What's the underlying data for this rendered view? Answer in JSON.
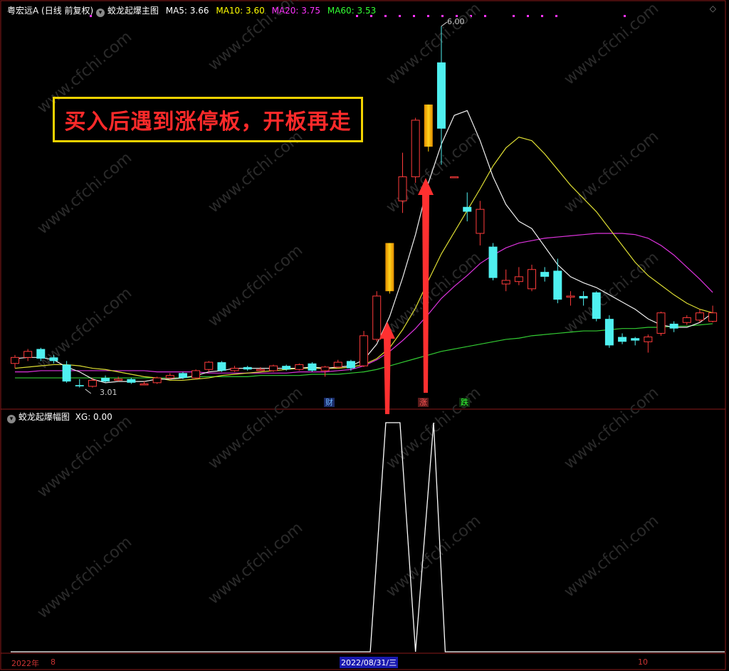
{
  "window": {
    "stock_name": "粤宏远A",
    "mode": "(日线 前复权)",
    "main_indicator": "蛟龙起爆主图",
    "ma": [
      {
        "label": "MA5: 3.66",
        "color": "#ffffff"
      },
      {
        "label": "MA10: 3.60",
        "color": "#ffff00"
      },
      {
        "label": "MA20: 3.75",
        "color": "#ff33ff"
      },
      {
        "label": "MA60: 3.53",
        "color": "#33ff33"
      }
    ],
    "sub_indicator": "蛟龙起爆幅图",
    "sub_value": "XG: 0.00"
  },
  "annotation": "买入后遇到涨停板，开板再走",
  "markers": [
    {
      "text": "财",
      "color": "#ff4444",
      "bg": "#1a2a66"
    },
    {
      "text": "涨",
      "color": "#ff4444",
      "bg": "#5a1a1a"
    },
    {
      "text": "跌",
      "color": "#33ff33",
      "bg": "#103010"
    }
  ],
  "price_labels": {
    "high": "6.00",
    "low": "3.01"
  },
  "xaxis": {
    "year": "2022年",
    "month1": "8",
    "cursor_date": "2022/08/31/三",
    "month2": "10"
  },
  "chart_data": {
    "type": "candlestick",
    "ylim": [
      2.85,
      6.1
    ],
    "candles": [
      {
        "o": 3.2,
        "c": 3.25,
        "h": 3.27,
        "l": 3.16
      },
      {
        "o": 3.25,
        "c": 3.3,
        "h": 3.32,
        "l": 3.22
      },
      {
        "o": 3.32,
        "c": 3.24,
        "h": 3.33,
        "l": 3.22
      },
      {
        "o": 3.25,
        "c": 3.22,
        "h": 3.27,
        "l": 3.2
      },
      {
        "o": 3.19,
        "c": 3.05,
        "h": 3.22,
        "l": 3.04
      },
      {
        "o": 3.02,
        "c": 3.01,
        "h": 3.07,
        "l": 3.0
      },
      {
        "o": 3.01,
        "c": 3.06,
        "h": 3.08,
        "l": 3.0
      },
      {
        "o": 3.08,
        "c": 3.05,
        "h": 3.1,
        "l": 3.04
      },
      {
        "o": 3.06,
        "c": 3.07,
        "h": 3.09,
        "l": 3.05
      },
      {
        "o": 3.07,
        "c": 3.04,
        "h": 3.08,
        "l": 3.03
      },
      {
        "o": 3.03,
        "c": 3.03,
        "h": 3.05,
        "l": 3.02
      },
      {
        "o": 3.04,
        "c": 3.08,
        "h": 3.09,
        "l": 3.03
      },
      {
        "o": 3.08,
        "c": 3.1,
        "h": 3.12,
        "l": 3.07
      },
      {
        "o": 3.12,
        "c": 3.08,
        "h": 3.13,
        "l": 3.07
      },
      {
        "o": 3.08,
        "c": 3.14,
        "h": 3.15,
        "l": 3.07
      },
      {
        "o": 3.15,
        "c": 3.21,
        "h": 3.22,
        "l": 3.13
      },
      {
        "o": 3.21,
        "c": 3.14,
        "h": 3.22,
        "l": 3.13
      },
      {
        "o": 3.14,
        "c": 3.16,
        "h": 3.18,
        "l": 3.13
      },
      {
        "o": 3.17,
        "c": 3.15,
        "h": 3.18,
        "l": 3.14
      },
      {
        "o": 3.15,
        "c": 3.15,
        "h": 3.17,
        "l": 3.14
      },
      {
        "o": 3.14,
        "c": 3.18,
        "h": 3.19,
        "l": 3.13
      },
      {
        "o": 3.18,
        "c": 3.15,
        "h": 3.19,
        "l": 3.14
      },
      {
        "o": 3.15,
        "c": 3.19,
        "h": 3.2,
        "l": 3.14
      },
      {
        "o": 3.2,
        "c": 3.14,
        "h": 3.21,
        "l": 3.13
      },
      {
        "o": 3.14,
        "c": 3.17,
        "h": 3.18,
        "l": 3.09
      },
      {
        "o": 3.17,
        "c": 3.21,
        "h": 3.23,
        "l": 3.16
      },
      {
        "o": 3.22,
        "c": 3.16,
        "h": 3.23,
        "l": 3.14
      },
      {
        "o": 3.18,
        "c": 3.43,
        "h": 3.47,
        "l": 3.17
      },
      {
        "o": 3.4,
        "c": 3.76,
        "h": 3.8,
        "l": 3.38
      },
      {
        "o": 3.8,
        "c": 4.2,
        "h": 4.2,
        "l": 3.78
      },
      {
        "o": 4.55,
        "c": 4.75,
        "h": 4.95,
        "l": 4.45
      },
      {
        "o": 4.75,
        "c": 5.22,
        "h": 5.24,
        "l": 4.7
      },
      {
        "o": 5.0,
        "c": 5.35,
        "h": 5.35,
        "l": 4.96
      },
      {
        "o": 5.7,
        "c": 5.15,
        "h": 6.0,
        "l": 4.85
      },
      {
        "o": 4.75,
        "c": 4.75,
        "h": 4.75,
        "l": 4.75
      },
      {
        "o": 4.5,
        "c": 4.46,
        "h": 4.62,
        "l": 4.38
      },
      {
        "o": 4.28,
        "c": 4.48,
        "h": 4.55,
        "l": 4.18
      },
      {
        "o": 4.17,
        "c": 3.91,
        "h": 4.2,
        "l": 3.89
      },
      {
        "o": 3.86,
        "c": 3.89,
        "h": 3.98,
        "l": 3.8
      },
      {
        "o": 3.88,
        "c": 3.92,
        "h": 4.0,
        "l": 3.85
      },
      {
        "o": 3.82,
        "c": 3.98,
        "h": 4.02,
        "l": 3.8
      },
      {
        "o": 3.96,
        "c": 3.92,
        "h": 4.0,
        "l": 3.88
      },
      {
        "o": 3.97,
        "c": 3.73,
        "h": 4.07,
        "l": 3.7
      },
      {
        "o": 3.75,
        "c": 3.76,
        "h": 3.8,
        "l": 3.68
      },
      {
        "o": 3.76,
        "c": 3.74,
        "h": 3.8,
        "l": 3.68
      },
      {
        "o": 3.79,
        "c": 3.57,
        "h": 3.8,
        "l": 3.55
      },
      {
        "o": 3.57,
        "c": 3.35,
        "h": 3.6,
        "l": 3.33
      },
      {
        "o": 3.42,
        "c": 3.38,
        "h": 3.45,
        "l": 3.36
      },
      {
        "o": 3.41,
        "c": 3.39,
        "h": 3.42,
        "l": 3.35
      },
      {
        "o": 3.38,
        "c": 3.42,
        "h": 3.44,
        "l": 3.29
      },
      {
        "o": 3.45,
        "c": 3.62,
        "h": 3.63,
        "l": 3.43
      },
      {
        "o": 3.53,
        "c": 3.49,
        "h": 3.55,
        "l": 3.46
      },
      {
        "o": 3.54,
        "c": 3.58,
        "h": 3.6,
        "l": 3.52
      },
      {
        "o": 3.56,
        "c": 3.62,
        "h": 3.65,
        "l": 3.54
      },
      {
        "o": 3.55,
        "c": 3.62,
        "h": 3.68,
        "l": 3.54
      }
    ],
    "limit_up_index": [
      29,
      32
    ],
    "ma5": [
      3.24,
      3.25,
      3.25,
      3.23,
      3.17,
      3.13,
      3.07,
      3.04,
      3.05,
      3.05,
      3.05,
      3.07,
      3.07,
      3.08,
      3.1,
      3.13,
      3.14,
      3.16,
      3.16,
      3.16,
      3.16,
      3.16,
      3.16,
      3.17,
      3.16,
      3.17,
      3.18,
      3.23,
      3.36,
      3.59,
      3.91,
      4.27,
      4.7,
      5.02,
      5.26,
      5.3,
      5.05,
      4.75,
      4.52,
      4.38,
      4.32,
      4.17,
      4.02,
      3.92,
      3.87,
      3.83,
      3.77,
      3.71,
      3.65,
      3.57,
      3.52,
      3.5,
      3.5,
      3.54,
      3.62
    ],
    "ma10": [
      3.16,
      3.17,
      3.18,
      3.19,
      3.19,
      3.18,
      3.16,
      3.15,
      3.13,
      3.11,
      3.09,
      3.08,
      3.06,
      3.06,
      3.07,
      3.08,
      3.1,
      3.11,
      3.12,
      3.13,
      3.14,
      3.15,
      3.16,
      3.16,
      3.16,
      3.16,
      3.17,
      3.19,
      3.24,
      3.33,
      3.48,
      3.66,
      3.89,
      4.11,
      4.29,
      4.47,
      4.65,
      4.84,
      4.99,
      5.08,
      5.05,
      4.94,
      4.81,
      4.68,
      4.57,
      4.46,
      4.32,
      4.18,
      4.04,
      3.93,
      3.85,
      3.77,
      3.7,
      3.65,
      3.62
    ],
    "ma20": [
      3.13,
      3.13,
      3.14,
      3.14,
      3.14,
      3.14,
      3.14,
      3.14,
      3.14,
      3.14,
      3.14,
      3.13,
      3.13,
      3.13,
      3.13,
      3.12,
      3.12,
      3.12,
      3.12,
      3.12,
      3.12,
      3.12,
      3.13,
      3.13,
      3.13,
      3.14,
      3.15,
      3.18,
      3.23,
      3.3,
      3.39,
      3.49,
      3.61,
      3.74,
      3.84,
      3.93,
      4.03,
      4.1,
      4.16,
      4.2,
      4.22,
      4.24,
      4.25,
      4.26,
      4.27,
      4.28,
      4.28,
      4.28,
      4.27,
      4.24,
      4.18,
      4.1,
      4.0,
      3.9,
      3.79
    ],
    "ma60": [
      3.08,
      3.08,
      3.08,
      3.08,
      3.08,
      3.08,
      3.08,
      3.08,
      3.08,
      3.08,
      3.08,
      3.08,
      3.08,
      3.08,
      3.09,
      3.09,
      3.09,
      3.09,
      3.09,
      3.1,
      3.1,
      3.1,
      3.1,
      3.11,
      3.11,
      3.11,
      3.12,
      3.13,
      3.15,
      3.18,
      3.21,
      3.24,
      3.27,
      3.3,
      3.32,
      3.34,
      3.36,
      3.38,
      3.4,
      3.41,
      3.43,
      3.44,
      3.45,
      3.46,
      3.47,
      3.47,
      3.48,
      3.49,
      3.49,
      3.5,
      3.5,
      3.51,
      3.51,
      3.52,
      3.53
    ],
    "xg_series": {
      "x_candle": [
        27.5,
        28.7,
        29.8,
        31.0,
        32.4,
        33.3,
        34.5,
        55
      ],
      "y": [
        0,
        1,
        1,
        0,
        1,
        0,
        0,
        0
      ]
    }
  }
}
